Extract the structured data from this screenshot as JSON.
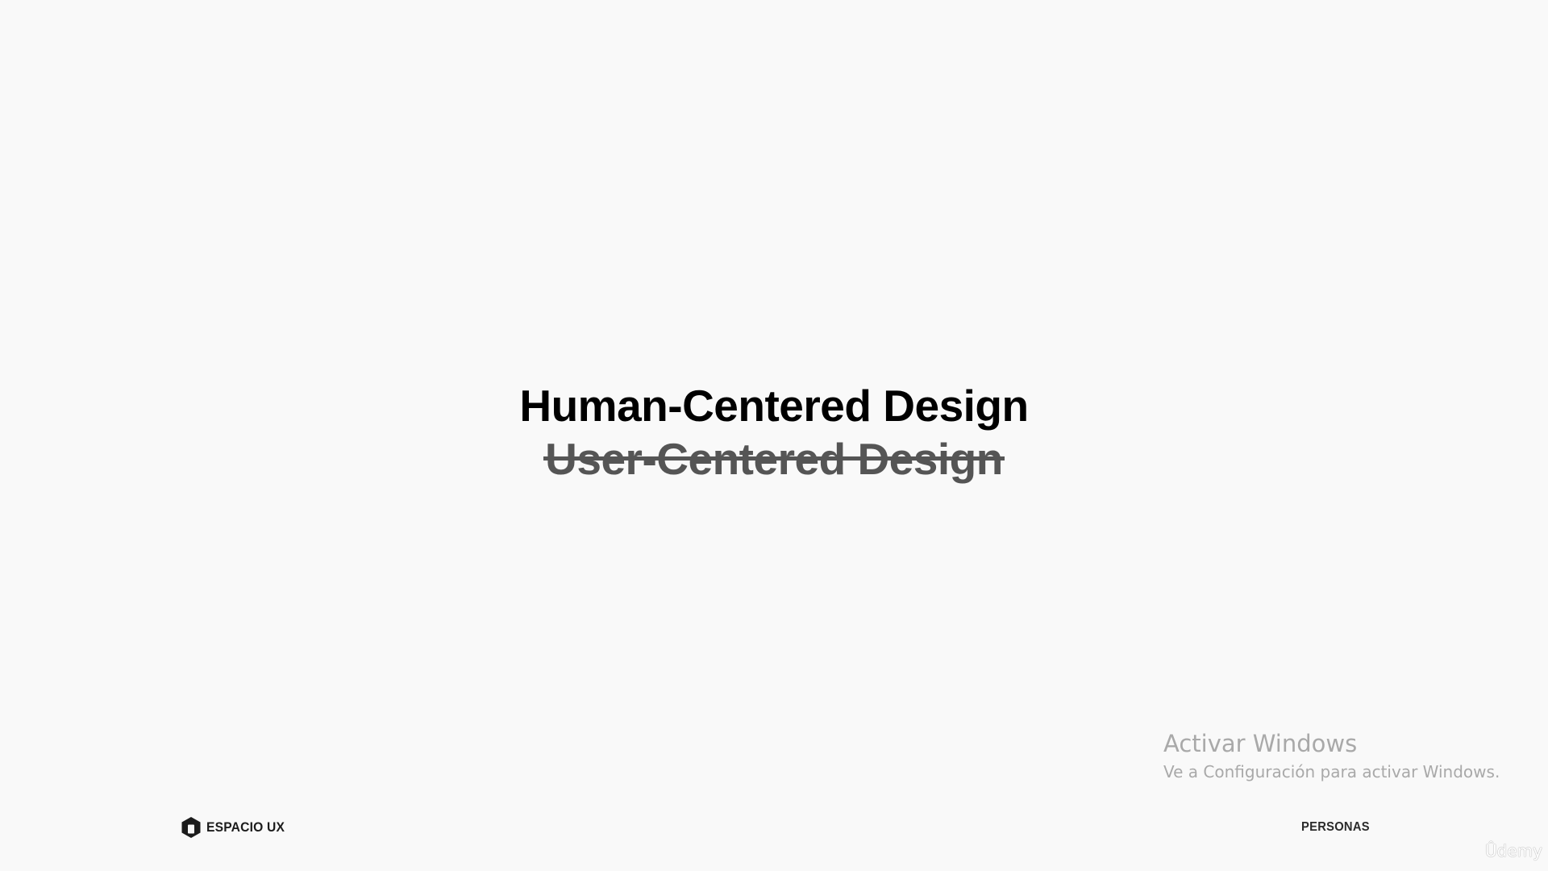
{
  "slide": {
    "headline": "Human-Centered Design",
    "struck_headline": "User-Centered Design"
  },
  "footer": {
    "brand_name": "ESPACIO UX",
    "section_label": "PERSONAS"
  },
  "windows_activation": {
    "title": "Activar Windows",
    "subtitle": "Ve a Configuración para activar Windows."
  },
  "watermark": {
    "text": "Ûdemy"
  },
  "icons": {
    "brand": "hexagon-logo-icon"
  },
  "colors": {
    "background": "#f9f9f9",
    "headline": "#000000",
    "struck_headline": "#555555",
    "activation_text": "#a9a9a9"
  }
}
